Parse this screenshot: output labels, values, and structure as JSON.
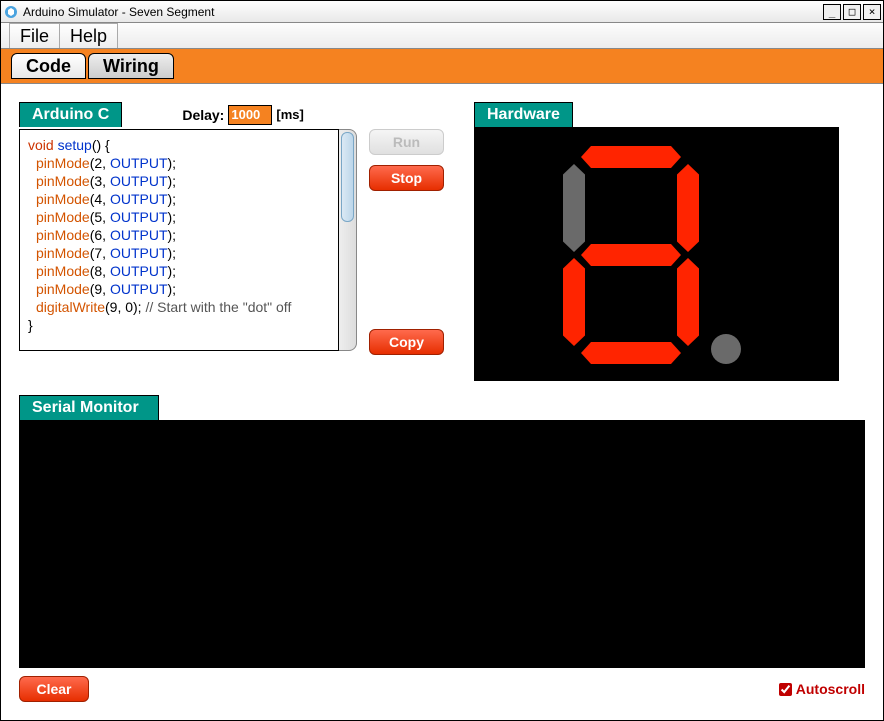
{
  "window": {
    "title": "Arduino Simulator - Seven Segment"
  },
  "menu": {
    "file": "File",
    "help": "Help"
  },
  "tabs": {
    "code": "Code",
    "wiring": "Wiring"
  },
  "panels": {
    "arduino_c": "Arduino C",
    "hardware": "Hardware",
    "serial": "Serial Monitor"
  },
  "delay": {
    "label": "Delay:",
    "value": "1000",
    "unit": "[ms]"
  },
  "buttons": {
    "run": "Run",
    "stop": "Stop",
    "copy": "Copy",
    "clear": "Clear"
  },
  "autoscroll": {
    "label": "Autoscroll",
    "checked": true
  },
  "code": {
    "lines": [
      {
        "t": "kw-red",
        "v": "void"
      },
      {
        "t": "txt",
        "v": " "
      },
      {
        "t": "kw-blue",
        "v": "setup"
      },
      {
        "t": "txt",
        "v": "() {"
      },
      {
        "t": "fn-orange",
        "v": "pinMode"
      },
      {
        "t": "txt",
        "v": "(2, "
      },
      {
        "t": "kw-blue",
        "v": "OUTPUT"
      },
      {
        "t": "txt",
        "v": ");"
      },
      {
        "t": "fn-orange",
        "v": "pinMode"
      },
      {
        "t": "txt",
        "v": "(3, "
      },
      {
        "t": "kw-blue",
        "v": "OUTPUT"
      },
      {
        "t": "txt",
        "v": ");"
      },
      {
        "t": "fn-orange",
        "v": "pinMode"
      },
      {
        "t": "txt",
        "v": "(4, "
      },
      {
        "t": "kw-blue",
        "v": "OUTPUT"
      },
      {
        "t": "txt",
        "v": ");"
      },
      {
        "t": "fn-orange",
        "v": "pinMode"
      },
      {
        "t": "txt",
        "v": "(5, "
      },
      {
        "t": "kw-blue",
        "v": "OUTPUT"
      },
      {
        "t": "txt",
        "v": ");"
      },
      {
        "t": "fn-orange",
        "v": "pinMode"
      },
      {
        "t": "txt",
        "v": "(6, "
      },
      {
        "t": "kw-blue",
        "v": "OUTPUT"
      },
      {
        "t": "txt",
        "v": ");"
      },
      {
        "t": "fn-orange",
        "v": "pinMode"
      },
      {
        "t": "txt",
        "v": "(7, "
      },
      {
        "t": "kw-blue",
        "v": "OUTPUT"
      },
      {
        "t": "txt",
        "v": ");"
      },
      {
        "t": "fn-orange",
        "v": "pinMode"
      },
      {
        "t": "txt",
        "v": "(8, "
      },
      {
        "t": "kw-blue",
        "v": "OUTPUT"
      },
      {
        "t": "txt",
        "v": ");"
      },
      {
        "t": "fn-orange",
        "v": "pinMode"
      },
      {
        "t": "txt",
        "v": "(9, "
      },
      {
        "t": "kw-blue",
        "v": "OUTPUT"
      },
      {
        "t": "txt",
        "v": ");"
      },
      {
        "t": "fn-orange",
        "v": "digitalWrite"
      },
      {
        "t": "txt",
        "v": "(9, 0);  "
      },
      {
        "t": "cm",
        "v": "// Start with the \"dot\" off"
      },
      {
        "t": "txt",
        "v": "}"
      }
    ]
  },
  "segments": {
    "a": true,
    "b": true,
    "c": true,
    "d": true,
    "e": true,
    "f": false,
    "g": true,
    "dp": false
  }
}
